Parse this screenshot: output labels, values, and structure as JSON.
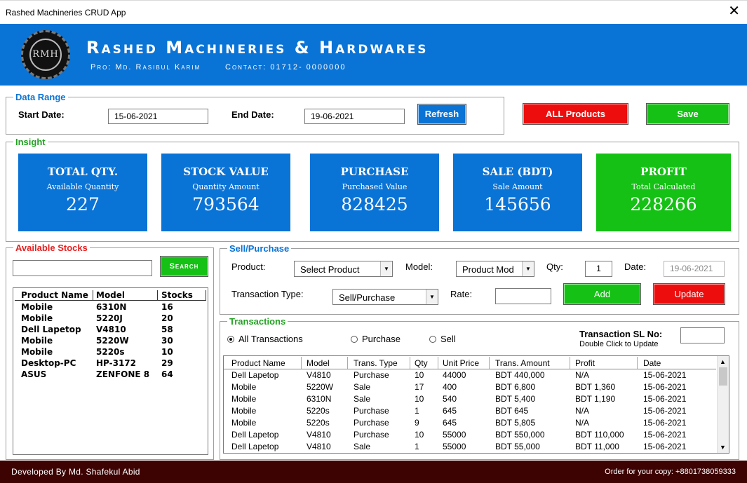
{
  "window": {
    "title": "Rashed Machineries CRUD App",
    "close_glyph": "✕"
  },
  "header": {
    "logo_text": "RMH",
    "brand": "Rashed Machineries & Hardwares",
    "proprietor": "Pro: Md. Rasibul Karim",
    "contact": "Contact: 01712- 0000000",
    "color": "#0a73d6"
  },
  "data_range": {
    "legend": "Data Range",
    "start_label": "Start Date:",
    "start_value": "15-06-2021",
    "end_label": "End Date:",
    "end_value": "19-06-2021",
    "refresh_label": "Refresh"
  },
  "top_actions": {
    "all_products_label": "ALL Products",
    "save_label": "Save"
  },
  "insight": {
    "legend": "Insight",
    "cards": [
      {
        "title": "TOTAL QTY.",
        "subtitle": "Available Quantity",
        "value": "227",
        "color": "#0a73d6"
      },
      {
        "title": "STOCK VALUE",
        "subtitle": "Quantity Amount",
        "value": "793564",
        "color": "#0a73d6"
      },
      {
        "title": "PURCHASE",
        "subtitle": "Purchased Value",
        "value": "828425",
        "color": "#0a73d6"
      },
      {
        "title": "SALE (BDT)",
        "subtitle": "Sale Amount",
        "value": "145656",
        "color": "#0a73d6"
      },
      {
        "title": "PROFIT",
        "subtitle": "Total Calculated",
        "value": "228266",
        "color": "#14c114"
      }
    ]
  },
  "stocks": {
    "legend": "Available Stocks",
    "search_value": "",
    "search_label": "Search",
    "columns": [
      "Product Name",
      "Model",
      "Stocks"
    ],
    "rows": [
      {
        "name": "Mobile",
        "model": "6310N",
        "stock": "16"
      },
      {
        "name": "Mobile",
        "model": "5220J",
        "stock": "20"
      },
      {
        "name": "Dell Lapetop",
        "model": "V4810",
        "stock": "58"
      },
      {
        "name": "Mobile",
        "model": "5220W",
        "stock": "30"
      },
      {
        "name": "Mobile",
        "model": "5220s",
        "stock": "10"
      },
      {
        "name": "Desktop-PC",
        "model": "HP-3172",
        "stock": "29"
      },
      {
        "name": "ASUS",
        "model": "ZENFONE 8",
        "stock": "64"
      }
    ]
  },
  "sell_purchase": {
    "legend": "Sell/Purchase",
    "product_label": "Product:",
    "product_value": "Select Product",
    "model_label": "Model:",
    "model_value": "Product Mod",
    "qty_label": "Qty:",
    "qty_value": "1",
    "date_label": "Date:",
    "date_value": "19-06-2021",
    "type_label": "Transaction Type:",
    "type_value": "Sell/Purchase",
    "rate_label": "Rate:",
    "rate_value": "",
    "add_label": "Add",
    "update_label": "Update"
  },
  "transactions": {
    "legend": "Transactions",
    "filters": [
      "All Transactions",
      "Purchase",
      "Sell"
    ],
    "selected_filter": "All Transactions",
    "sl_label": "Transaction SL No:",
    "sl_hint": "Double Click to Update",
    "sl_value": "",
    "columns": [
      "Product Name",
      "Model",
      "Trans. Type",
      "Qty",
      "Unit Price",
      "Trans. Amount",
      "Profit",
      "Date"
    ],
    "rows": [
      [
        "Dell Lapetop",
        "V4810",
        "Purchase",
        "10",
        "44000",
        "BDT 440,000",
        "N/A",
        "15-06-2021"
      ],
      [
        "Mobile",
        "5220W",
        "Sale",
        "17",
        "400",
        "BDT 6,800",
        "BDT 1,360",
        "15-06-2021"
      ],
      [
        "Mobile",
        "6310N",
        "Sale",
        "10",
        "540",
        "BDT 5,400",
        "BDT 1,190",
        "15-06-2021"
      ],
      [
        "Mobile",
        "5220s",
        "Purchase",
        "1",
        "645",
        "BDT 645",
        "N/A",
        "15-06-2021"
      ],
      [
        "Mobile",
        "5220s",
        "Purchase",
        "9",
        "645",
        "BDT 5,805",
        "N/A",
        "15-06-2021"
      ],
      [
        "Dell Lapetop",
        "V4810",
        "Purchase",
        "10",
        "55000",
        "BDT 550,000",
        "BDT 110,000",
        "15-06-2021"
      ],
      [
        "Dell Lapetop",
        "V4810",
        "Sale",
        "1",
        "55000",
        "BDT 55,000",
        "BDT 11,000",
        "15-06-2021"
      ]
    ]
  },
  "footer": {
    "developer": "Developed By Md. Shafekul Abid",
    "order": "Order for your copy: +8801738059333"
  }
}
